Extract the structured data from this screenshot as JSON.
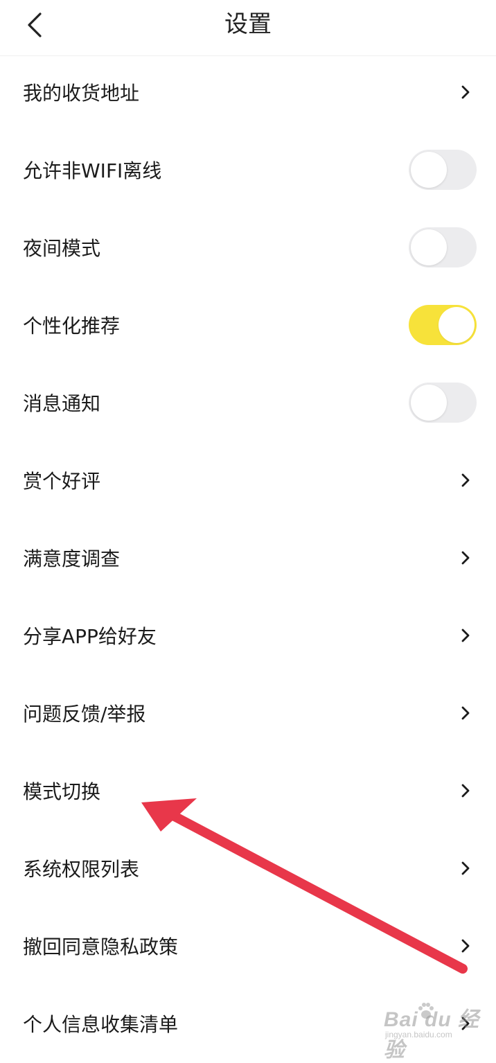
{
  "header": {
    "title": "设置",
    "back_icon": "chevron-left-icon"
  },
  "settings": [
    {
      "label": "我的收货地址",
      "control": "chevron"
    },
    {
      "label": "允许非WIFI离线",
      "control": "toggle",
      "on": false
    },
    {
      "label": "夜间模式",
      "control": "toggle",
      "on": false
    },
    {
      "label": "个性化推荐",
      "control": "toggle",
      "on": true
    },
    {
      "label": "消息通知",
      "control": "toggle",
      "on": false
    },
    {
      "label": "赏个好评",
      "control": "chevron"
    },
    {
      "label": "满意度调查",
      "control": "chevron"
    },
    {
      "label": "分享APP给好友",
      "control": "chevron"
    },
    {
      "label": "问题反馈/举报",
      "control": "chevron"
    },
    {
      "label": "模式切换",
      "control": "chevron"
    },
    {
      "label": "系统权限列表",
      "control": "chevron"
    },
    {
      "label": "撤回同意隐私政策",
      "control": "chevron"
    },
    {
      "label": "个人信息收集清单",
      "control": "chevron"
    }
  ],
  "colors": {
    "toggle_on": "#f7e23a",
    "toggle_off": "#ececee",
    "annotation_arrow": "#e8374a"
  },
  "watermark": {
    "brand": "Bai du 经验",
    "sub": "jingyan.baidu.com"
  }
}
